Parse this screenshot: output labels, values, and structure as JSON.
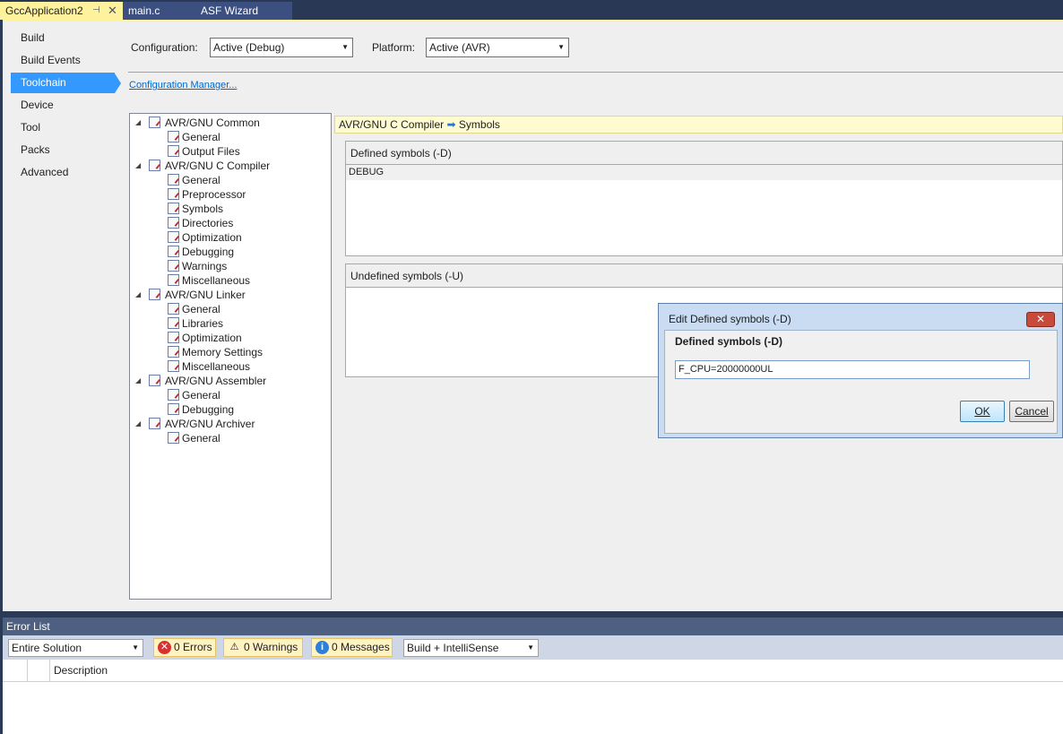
{
  "tabs": {
    "active": "GccApplication2",
    "active_pin": "⊣",
    "active_close": "✕",
    "second": "main.c",
    "third": "ASF Wizard"
  },
  "nav": {
    "items": [
      "Build",
      "Build Events",
      "Toolchain",
      "Device",
      "Tool",
      "Packs",
      "Advanced"
    ],
    "selected": "Toolchain"
  },
  "config": {
    "configuration_label": "Configuration:",
    "configuration_value": "Active (Debug)",
    "platform_label": "Platform:",
    "platform_value": "Active (AVR)",
    "manager_link": "Configuration Manager..."
  },
  "tree": {
    "common": "AVR/GNU Common",
    "common_general": "General",
    "common_output": "Output Files",
    "compiler": "AVR/GNU C Compiler",
    "compiler_general": "General",
    "compiler_preprocessor": "Preprocessor",
    "compiler_symbols": "Symbols",
    "compiler_directories": "Directories",
    "compiler_optimization": "Optimization",
    "compiler_debugging": "Debugging",
    "compiler_warnings": "Warnings",
    "compiler_misc": "Miscellaneous",
    "linker": "AVR/GNU Linker",
    "linker_general": "General",
    "linker_libraries": "Libraries",
    "linker_optimization": "Optimization",
    "linker_memory": "Memory Settings",
    "linker_misc": "Miscellaneous",
    "assembler": "AVR/GNU Assembler",
    "assembler_general": "General",
    "assembler_debugging": "Debugging",
    "archiver": "AVR/GNU Archiver",
    "archiver_general": "General"
  },
  "panel": {
    "crumb_left": "AVR/GNU C Compiler",
    "crumb_arrow": "➡",
    "crumb_right": "Symbols",
    "defined_header": "Defined symbols (-D)",
    "defined_values": [
      "DEBUG"
    ],
    "undefined_header": "Undefined symbols (-U)"
  },
  "dialog": {
    "title": "Edit Defined symbols (-D)",
    "close": "✕",
    "label": "Defined symbols (-D)",
    "value": "F_CPU=20000000UL",
    "ok": "OK",
    "cancel": "Cancel"
  },
  "errors": {
    "title": "Error List",
    "scope": "Entire Solution",
    "errors": "0 Errors",
    "warnings": "0 Warnings",
    "messages": "0 Messages",
    "filter": "Build + IntelliSense",
    "col_description": "Description"
  }
}
